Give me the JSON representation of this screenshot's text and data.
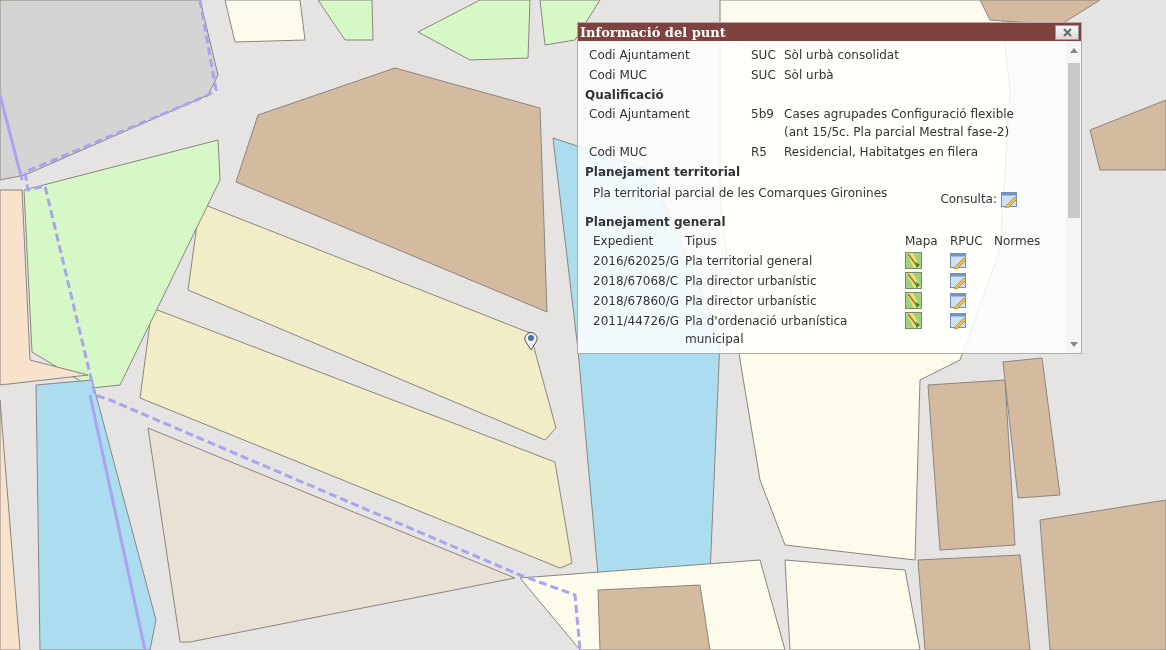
{
  "popup": {
    "title": "Informació del punt",
    "top_rows": [
      {
        "label": "Codi Ajuntament",
        "code": "SUC",
        "description": "Sòl urbà consolidat"
      },
      {
        "label": "Codi MUC",
        "code": "SUC",
        "description": "Sòl urbà"
      }
    ],
    "sections": [
      {
        "kind": "rows",
        "heading": "Qualificació",
        "rows": [
          {
            "label": "Codi Ajuntament",
            "code": "5b9",
            "description": "Cases agrupades Configuració flexible (ant 15/5c. Pla parcial Mestral fase-2)"
          },
          {
            "label": "Codi MUC",
            "code": "R5",
            "description": "Residencial, Habitatges en filera"
          }
        ]
      },
      {
        "kind": "consult",
        "heading": "Planejament territorial",
        "text": "Pla territorial parcial de les Comarques Gironines",
        "label": "Consulta:"
      },
      {
        "kind": "table",
        "heading": "Planejament general",
        "columns": [
          "Expedient",
          "Tipus",
          "Mapa",
          "RPUC",
          "Normes"
        ],
        "rows": [
          {
            "expedient": "2016/62025/G",
            "tipus": "Pla territorial general"
          },
          {
            "expedient": "2018/67068/C",
            "tipus": "Pla director urbanístic"
          },
          {
            "expedient": "2018/67860/G",
            "tipus": "Pla director urbanístic"
          },
          {
            "expedient": "2011/44726/G",
            "tipus": "Pla d'ordenació urbanística municipal"
          }
        ]
      }
    ]
  }
}
